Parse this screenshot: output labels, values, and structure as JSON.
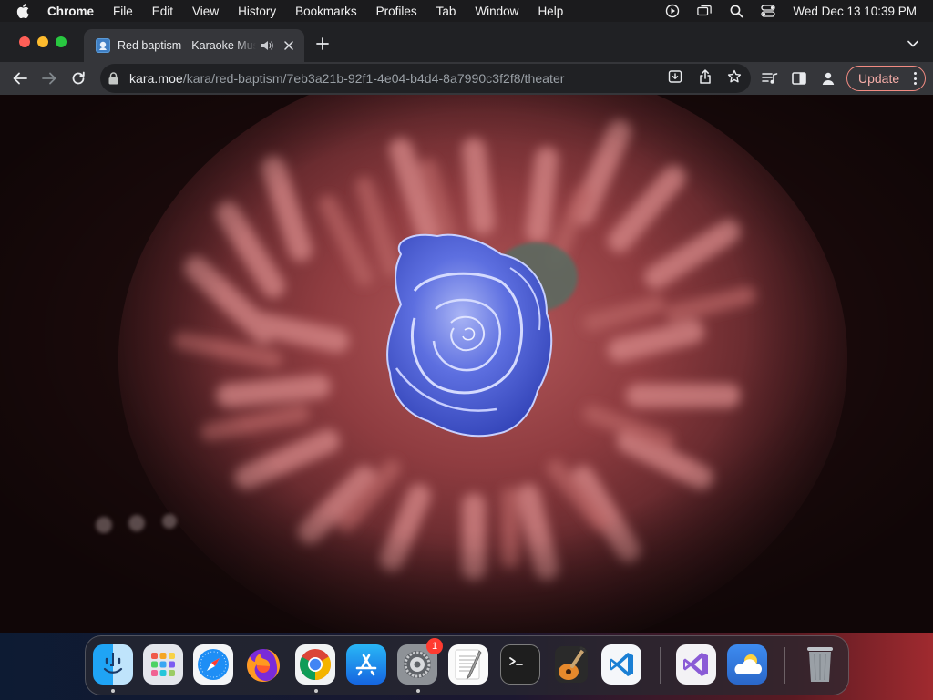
{
  "menubar": {
    "app_name": "Chrome",
    "items": [
      "File",
      "Edit",
      "View",
      "History",
      "Bookmarks",
      "Profiles",
      "Tab",
      "Window",
      "Help"
    ],
    "clock": "Wed Dec 13  10:39 PM"
  },
  "tab": {
    "title": "Red baptism - Karaoke Music"
  },
  "omnibox": {
    "host": "kara.moe",
    "path": "/kara/red-baptism/7eb3a21b-92f1-4e04-b4d4-8a7990c3f2f8/theater"
  },
  "toolbar": {
    "update_label": "Update"
  },
  "dock": {
    "apps": [
      "finder-icon",
      "launchpad-icon",
      "safari-icon",
      "firefox-icon",
      "chrome-icon",
      "app-store-icon",
      "system-settings-icon",
      "textedit-icon",
      "terminal-icon",
      "garageband-icon",
      "vscode-icon",
      "visual-studio-icon",
      "weather-icon",
      "trash-icon"
    ],
    "settings_badge": "1"
  },
  "colors": {
    "tab_active": "#35363a",
    "tab_strip": "#202124",
    "update_border": "#f28b82",
    "rose": "#5a6ee0"
  }
}
